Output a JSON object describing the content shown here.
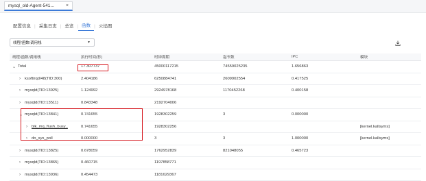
{
  "doc_tab": {
    "label": "mysql_old-Agent-541...",
    "close": "×"
  },
  "subtabs": [
    {
      "label": "配置信息",
      "active": false
    },
    {
      "label": "采集日志",
      "active": false
    },
    {
      "label": "总览",
      "active": false
    },
    {
      "label": "函数",
      "active": true
    },
    {
      "label": "火焰图",
      "active": false
    }
  ],
  "group_select": {
    "value": "线程/函数/调用栈"
  },
  "columns": [
    "线程/函数/调用栈",
    "执行时间(秒)",
    "时钟周期",
    "指令数",
    "IPC",
    "模块"
  ],
  "rows": [
    {
      "name": "Total",
      "indent": 0,
      "arrow": "expanded",
      "time": "17.307737",
      "cycles": "45000117215",
      "instr": "74559025235",
      "ipc": "1.656863",
      "module": ""
    },
    {
      "name": "ksoftirqd/48(TID:300)",
      "indent": 1,
      "arrow": "collapsed",
      "time": "2.404186",
      "cycles": "6250884741",
      "instr": "2609902554",
      "ipc": "0.417525",
      "module": ""
    },
    {
      "name": "mysqld(TID:13925)",
      "indent": 1,
      "arrow": "collapsed",
      "time": "1.124992",
      "cycles": "2924978168",
      "instr": "1170452268",
      "ipc": "0.400158",
      "module": ""
    },
    {
      "name": "mysqld(TID:13511)",
      "indent": 1,
      "arrow": "collapsed",
      "time": "0.843348",
      "cycles": "2192704006",
      "instr": "",
      "ipc": "",
      "module": ""
    },
    {
      "name": "mysqld(TID:13841)",
      "indent": 1,
      "arrow": "expanded",
      "time": "0.741655",
      "cycles": "1928302259",
      "instr": "3",
      "ipc": "0.000000",
      "module": ""
    },
    {
      "name": "blk_mq_flush_busy_",
      "indent": 2,
      "arrow": "collapsed",
      "time": "0.741655",
      "cycles": "1928302256",
      "instr": "",
      "ipc": "",
      "module": "[kernel.kallsyms]"
    },
    {
      "name": "do_sys_poll",
      "indent": 2,
      "arrow": "collapsed",
      "time": "0.000000",
      "cycles": "3",
      "instr": "3",
      "ipc": "1.000000",
      "module": "[kernel.kallsyms]"
    },
    {
      "name": "mysqld(TID:13825)",
      "indent": 1,
      "arrow": "collapsed",
      "time": "0.678059",
      "cycles": "1762952839",
      "instr": "821048055",
      "ipc": "0.465723",
      "module": ""
    },
    {
      "name": "mysqld(TID:13865)",
      "indent": 1,
      "arrow": "collapsed",
      "time": "0.460715",
      "cycles": "1197858771",
      "instr": "",
      "ipc": "",
      "module": ""
    },
    {
      "name": "mysqld(TID:13936)",
      "indent": 1,
      "arrow": "collapsed",
      "time": "0.454473",
      "cycles": "1181629367",
      "instr": "",
      "ipc": "",
      "module": ""
    }
  ],
  "icons": {
    "download": "download-icon",
    "expanded": "chevron-down-icon",
    "collapsed": "chevron-right-icon"
  },
  "colors": {
    "accent": "#3d7bd8",
    "highlight": "#d5141b"
  }
}
